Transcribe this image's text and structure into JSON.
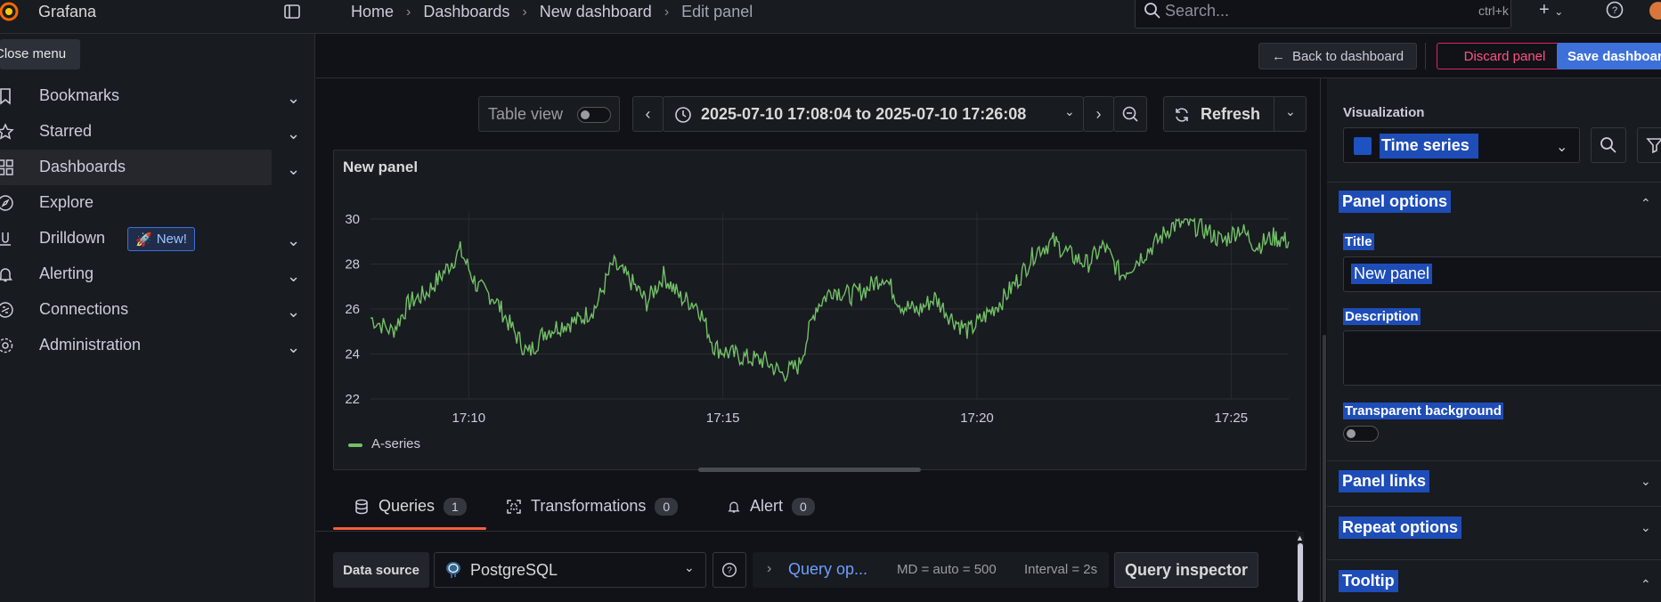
{
  "app": {
    "title": "Grafana"
  },
  "breadcrumb": [
    "Home",
    "Dashboards",
    "New dashboard",
    "Edit panel"
  ],
  "search": {
    "placeholder": "Search...",
    "shortcut": "ctrl+k"
  },
  "sidebar": {
    "tooltip": "Close menu",
    "items": [
      {
        "label": "Bookmarks",
        "icon": "bookmark-icon"
      },
      {
        "label": "Starred",
        "icon": "star-icon"
      },
      {
        "label": "Dashboards",
        "icon": "apps-icon",
        "active": true
      },
      {
        "label": "Explore",
        "icon": "compass-icon"
      },
      {
        "label": "Drilldown",
        "icon": "drilldown-icon",
        "badge": "New!"
      },
      {
        "label": "Alerting",
        "icon": "bell-icon"
      },
      {
        "label": "Connections",
        "icon": "connections-icon"
      },
      {
        "label": "Administration",
        "icon": "gear-icon"
      }
    ]
  },
  "actions": {
    "back": "Back to dashboard",
    "discard": "Discard panel",
    "save": "Save dashboard"
  },
  "toolbar": {
    "table_view": "Table view",
    "time_range": "2025-07-10 17:08:04 to 2025-07-10 17:26:08",
    "refresh": "Refresh"
  },
  "panel": {
    "title": "New panel",
    "legend": "A-series"
  },
  "chart_data": {
    "type": "line",
    "x_ticks": [
      "17:10",
      "17:15",
      "17:20",
      "17:25"
    ],
    "y_ticks": [
      22,
      24,
      26,
      28,
      30
    ],
    "ylim": [
      22,
      30
    ],
    "xlim": [
      "17:08:04",
      "17:26:08"
    ],
    "grid": true,
    "legend_position": "bottom-left",
    "series": [
      {
        "name": "A-series",
        "color": "#73bf69",
        "x": [
          "17:08:04",
          "17:08:30",
          "17:08:50",
          "17:09:10",
          "17:09:30",
          "17:09:50",
          "17:10:10",
          "17:10:30",
          "17:10:50",
          "17:11:10",
          "17:11:30",
          "17:11:50",
          "17:12:10",
          "17:12:30",
          "17:12:50",
          "17:13:10",
          "17:13:30",
          "17:13:50",
          "17:14:10",
          "17:14:30",
          "17:14:50",
          "17:15:10",
          "17:15:30",
          "17:15:50",
          "17:16:10",
          "17:16:30",
          "17:16:50",
          "17:17:10",
          "17:17:30",
          "17:17:50",
          "17:18:10",
          "17:18:30",
          "17:18:50",
          "17:19:10",
          "17:19:30",
          "17:19:50",
          "17:20:10",
          "17:20:30",
          "17:20:50",
          "17:21:10",
          "17:21:30",
          "17:21:50",
          "17:22:10",
          "17:22:30",
          "17:22:50",
          "17:23:10",
          "17:23:30",
          "17:23:50",
          "17:24:10",
          "17:24:30",
          "17:24:50",
          "17:25:10",
          "17:25:30",
          "17:25:50",
          "17:26:08"
        ],
        "values": [
          25.6,
          25.0,
          26.3,
          26.7,
          27.6,
          28.6,
          27.0,
          26.5,
          25.2,
          24.0,
          25.0,
          25.3,
          25.5,
          26.1,
          28.0,
          27.3,
          26.3,
          27.5,
          26.5,
          26.2,
          24.3,
          24.0,
          23.8,
          23.7,
          23.1,
          23.5,
          26.1,
          26.9,
          26.6,
          26.9,
          27.5,
          26.2,
          25.9,
          26.5,
          25.6,
          25.0,
          25.7,
          26.4,
          27.4,
          28.6,
          29.0,
          28.4,
          28.0,
          28.8,
          27.5,
          28.2,
          28.9,
          29.7,
          29.8,
          29.5,
          29.0,
          29.6,
          28.8,
          29.2,
          29.0
        ]
      }
    ]
  },
  "query_tabs": [
    {
      "label": "Queries",
      "count": "1"
    },
    {
      "label": "Transformations",
      "count": "0"
    },
    {
      "label": "Alert",
      "count": "0"
    }
  ],
  "query": {
    "data_source_label": "Data source",
    "data_source": "PostgreSQL",
    "options_link": "Query op...",
    "md": "MD = auto = 500",
    "interval": "Interval = 2s",
    "inspector": "Query inspector"
  },
  "options": {
    "visualization_label": "Visualization",
    "visualization": "Time series",
    "sections": [
      "Panel options",
      "Panel links",
      "Repeat options",
      "Tooltip"
    ],
    "title_label": "Title",
    "title_value": "New panel",
    "description_label": "Description",
    "transparent_label": "Transparent background"
  },
  "colors": {
    "accent": "#3d71d9",
    "danger": "#ff5286",
    "series": "#73bf69",
    "tab_active": "#f55f3e",
    "selection": "#1e4db8"
  }
}
